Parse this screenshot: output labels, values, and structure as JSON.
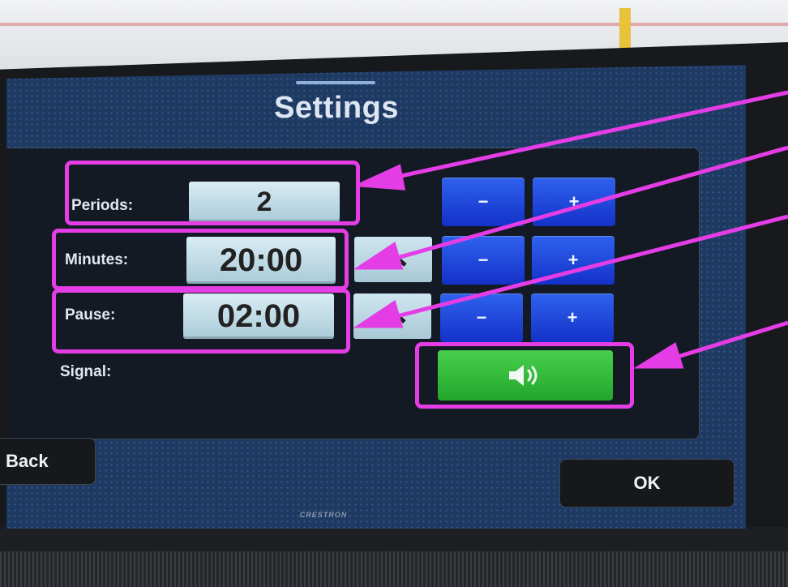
{
  "screen": {
    "title": "Settings"
  },
  "rows": {
    "periods": {
      "label": "Periods:",
      "value": "2",
      "minus": "−",
      "plus": "+"
    },
    "minutes": {
      "label": "Minutes:",
      "value": "20:00",
      "minus": "−",
      "plus": "+"
    },
    "pause": {
      "label": "Pause:",
      "value": "02:00",
      "minus": "−",
      "plus": "+"
    }
  },
  "signal": {
    "label": "Signal:",
    "button_icon": "speaker-sound-icon"
  },
  "footer": {
    "back_label": "Back",
    "ok_label": "OK",
    "brand": "CRESTRON"
  },
  "annotations": {
    "color": "#e43de6"
  },
  "colors": {
    "button_blue": "#1f46dc",
    "button_green": "#2fb836",
    "field_light": "#c4e0ec",
    "screen_bg": "#1e3a63"
  }
}
